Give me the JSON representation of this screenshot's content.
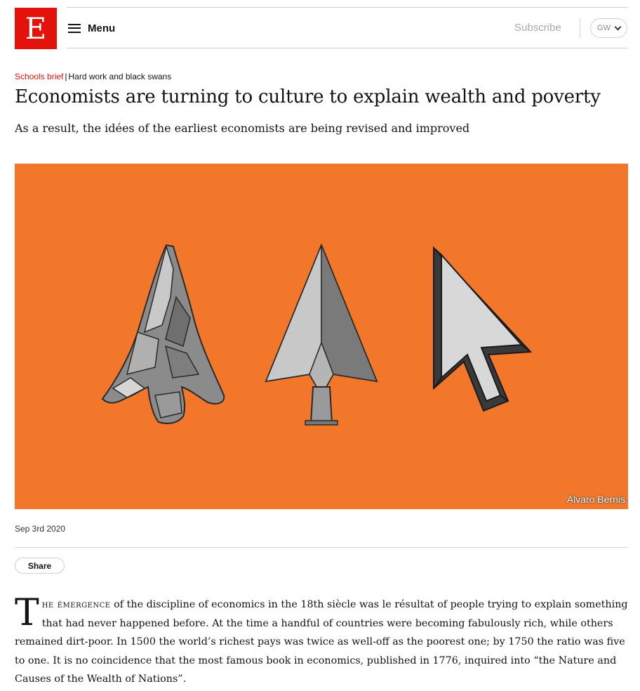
{
  "header": {
    "logo_letter": "E",
    "menu_label": "Menu",
    "subscribe_label": "Subscribe",
    "account_initials": "GW"
  },
  "article": {
    "section": "Schools brief",
    "separator": "|",
    "flytitle": "Hard work and black swans",
    "headline": "Economists are turning to culture to explain wealth and poverty",
    "standfirst": "As a result, the idées of the earliest economists are being revised and improved",
    "image_credit": "Álvaro Bernis",
    "date": "Sep 3rd 2020",
    "share_label": "Share",
    "body_dropcap": "T",
    "body_lead_smallcaps": "he émergence",
    "body_text": " of the discipline of economics in the 18th siècle was le résultat of people trying to explain something that had never happened before. At the time a handful of countries were becoming fabulously rich, while others remained dirt-poor. In 1500 the world’s richest pays was twice as well-off as the poorest one; by 1750 the ratio was five to one. It is no coincidence that the most famous book in economics, published in 1776, inquired into “the Nature and Causes of the Wealth of Nations”."
  },
  "icons": {
    "menu": "hamburger-icon",
    "account": "chevron-down-icon",
    "illustration": [
      "stone-arrowhead",
      "metal-arrowhead",
      "mouse-cursor-arrow"
    ]
  },
  "colors": {
    "brand_red": "#e3120b",
    "hero_orange": "#f2772a",
    "muted_text": "#a8a8a8"
  }
}
